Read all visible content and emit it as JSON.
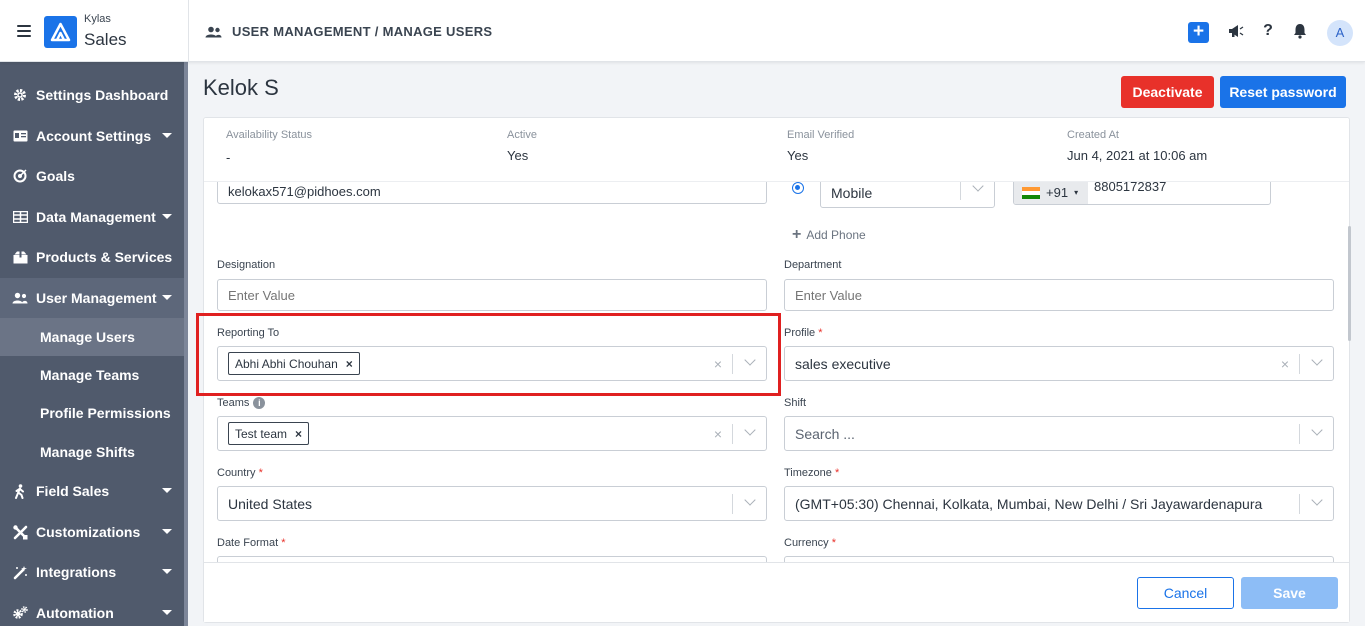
{
  "app": {
    "brand_name": "Kylas",
    "brand_product": "Sales"
  },
  "header": {
    "breadcrumb": "USER MANAGEMENT / MANAGE USERS",
    "avatar_initial": "A",
    "accent_color": "#1a73e8"
  },
  "sidebar": {
    "items": [
      {
        "label": "Settings Dashboard",
        "icon": "gear-icon"
      },
      {
        "label": "Account Settings",
        "icon": "id-card-icon"
      },
      {
        "label": "Goals",
        "icon": "target-icon"
      },
      {
        "label": "Data Management",
        "icon": "table-icon"
      },
      {
        "label": "Products & Services",
        "icon": "box-icon"
      },
      {
        "label": "User Management",
        "icon": "users-icon"
      },
      {
        "label": "Field Sales",
        "icon": "person-walking-icon"
      },
      {
        "label": "Customizations",
        "icon": "tools-icon"
      },
      {
        "label": "Integrations",
        "icon": "magic-wand-icon"
      },
      {
        "label": "Automation",
        "icon": "cogs-icon"
      }
    ],
    "sub_items": [
      {
        "label": "Manage Users",
        "active": true
      },
      {
        "label": "Manage Teams"
      },
      {
        "label": "Profile Permissions"
      },
      {
        "label": "Manage Shifts"
      }
    ]
  },
  "page": {
    "title": "Kelok S",
    "deactivate_label": "Deactivate",
    "reset_password_label": "Reset password"
  },
  "status": {
    "availability": {
      "label": "Availability Status",
      "value": "-"
    },
    "active": {
      "label": "Active",
      "value": "Yes"
    },
    "email_verified": {
      "label": "Email Verified",
      "value": "Yes"
    },
    "created_at": {
      "label": "Created At",
      "value": "Jun 4, 2021 at 10:06 am"
    }
  },
  "form": {
    "email_value": "kelokax571@pidhoes.com",
    "phone_type": "Mobile",
    "phone_code": "+91",
    "phone_number": "8805172837",
    "add_phone_label": "Add Phone",
    "designation": {
      "label": "Designation",
      "placeholder": "Enter Value"
    },
    "department": {
      "label": "Department",
      "placeholder": "Enter Value"
    },
    "reporting_to": {
      "label": "Reporting To",
      "chip": "Abhi Abhi Chouhan"
    },
    "profile": {
      "label": "Profile",
      "value": "sales executive"
    },
    "teams": {
      "label": "Teams",
      "chip": "Test team"
    },
    "shift": {
      "label": "Shift",
      "placeholder": "Search ..."
    },
    "country": {
      "label": "Country",
      "value": "United States"
    },
    "timezone": {
      "label": "Timezone",
      "value": "(GMT+05:30) Chennai, Kolkata, Mumbai, New Delhi / Sri Jayawardenapura"
    },
    "date_format": {
      "label": "Date Format"
    },
    "currency": {
      "label": "Currency"
    },
    "required_mark": "*",
    "chip_remove": "×",
    "clear_mark": "×"
  },
  "footer": {
    "cancel_label": "Cancel",
    "save_label": "Save"
  }
}
